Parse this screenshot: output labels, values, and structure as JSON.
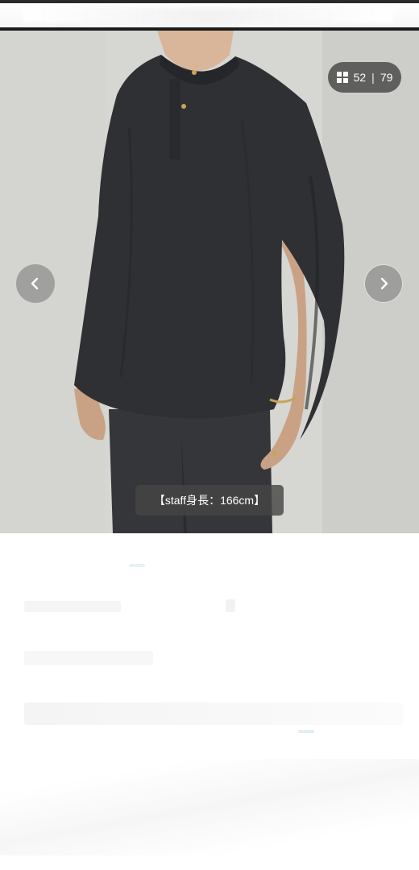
{
  "gallery": {
    "counter": {
      "icon": "grid-icon",
      "current": "52",
      "separator": "|",
      "total": "79"
    },
    "caption": "【staff身長：166cm】",
    "prev_icon": "chevron-left-icon",
    "next_icon": "chevron-right-icon"
  },
  "colors": {
    "wall": "#d4d4d0",
    "garment": "#2f3034",
    "overlay": "#4b4b4b"
  }
}
